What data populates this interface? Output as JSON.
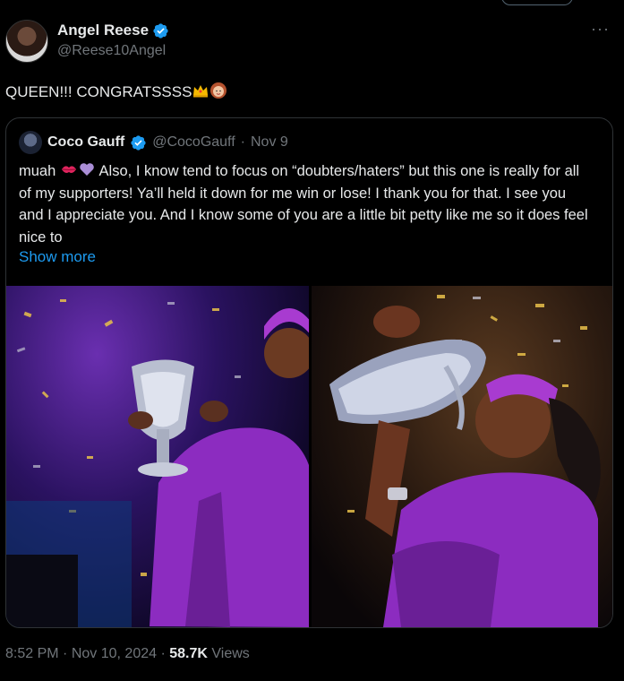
{
  "author": {
    "display_name": "Angel Reese",
    "handle": "@Reese10Angel"
  },
  "tweet": {
    "text": "QUEEN!!! CONGRATSSSS",
    "emojis": [
      "crown-emoji",
      "woman-emoji"
    ]
  },
  "quote": {
    "display_name": "Coco Gauff",
    "handle": "@CocoGauff",
    "separator": "·",
    "date": "Nov 9",
    "lead": "muah",
    "emojis": [
      "kiss-mark-emoji",
      "purple-heart-emoji"
    ],
    "text": " Also, I know tend to focus on “doubters/haters” but this one is really for all of my supporters! Ya’ll held it down for me win or lose! I thank you for that. I see you and I appreciate you.  And I know some of you are a little bit petty like me so it does feel nice to",
    "show_more": "Show more"
  },
  "meta": {
    "time": "8:52 PM",
    "dot1": "·",
    "date": "Nov 10, 2024",
    "dot2": "·",
    "views_count": "58.7K",
    "views_label": "Views"
  },
  "colors": {
    "background": "#000000",
    "text": "#e7e9ea",
    "muted": "#71767b",
    "link": "#1d9bf0",
    "verified": "#1d9bf0",
    "border": "#2f3336"
  },
  "icons": [
    "verified-badge-icon",
    "more-icon"
  ]
}
